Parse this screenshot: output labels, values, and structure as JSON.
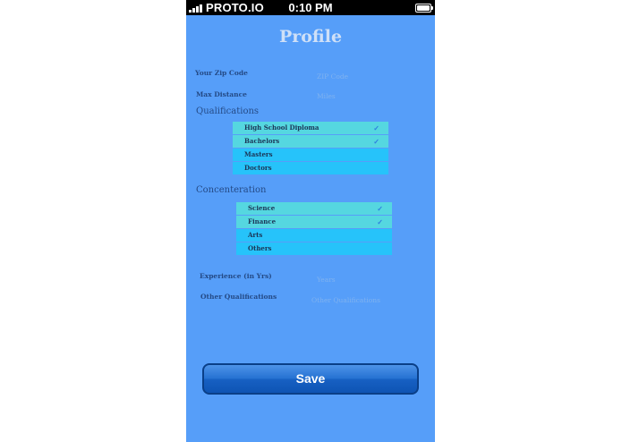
{
  "statusbar": {
    "carrier": "PROTO.IO",
    "time": "0:10 PM"
  },
  "page": {
    "title": "Profile"
  },
  "fields": {
    "zip": {
      "label": "Your Zip Code",
      "placeholder": "ZIP Code"
    },
    "distance": {
      "label": "Max Distance",
      "placeholder": "Miles"
    },
    "experience": {
      "label": "Experience (in Yrs)",
      "placeholder": "Years"
    },
    "other": {
      "label": "Other Qualifications",
      "placeholder": "Other Qualifications"
    }
  },
  "qualifications": {
    "title": "Qualifications",
    "items": [
      {
        "label": "High School Diploma",
        "selected": true
      },
      {
        "label": "Bachelors",
        "selected": true
      },
      {
        "label": "Masters",
        "selected": false
      },
      {
        "label": "Doctors",
        "selected": false
      }
    ]
  },
  "concentration": {
    "title": "Concenteration",
    "items": [
      {
        "label": "Science",
        "selected": true
      },
      {
        "label": "Finance",
        "selected": true
      },
      {
        "label": "Arts",
        "selected": false
      },
      {
        "label": "Others",
        "selected": false
      }
    ]
  },
  "actions": {
    "save_label": "Save"
  },
  "colors": {
    "background": "#569ef9",
    "list_item": "#26c3fa",
    "list_item_selected": "#55d7e0",
    "save_button": "#1760c3"
  },
  "icons": {
    "check": "check-icon",
    "signal": "signal-icon",
    "battery": "battery-icon"
  }
}
